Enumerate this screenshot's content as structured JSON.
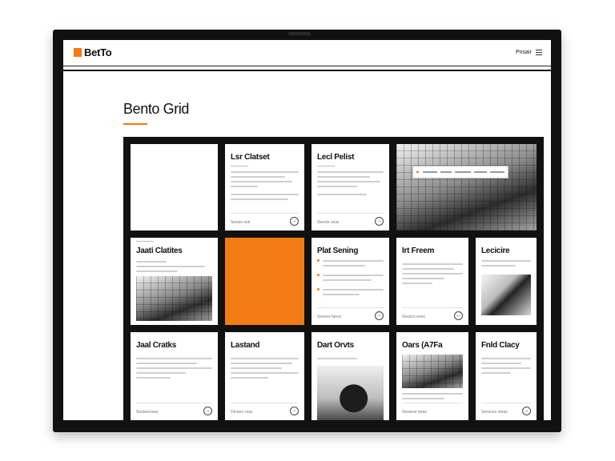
{
  "header": {
    "logo_text": "BetTo",
    "nav_label": "Pnsair",
    "accent_color": "#f27c13"
  },
  "page": {
    "title": "Bento Grid"
  },
  "cards": [
    {
      "id": "blank",
      "title": ""
    },
    {
      "id": "c2",
      "title": "Lsr Clatset",
      "footer": "Sessio ook",
      "icon": "arrow-right-icon"
    },
    {
      "id": "c3",
      "title": "Lecl Pelist",
      "footer": "Seecte seas",
      "icon": "arrow-right-icon"
    },
    {
      "id": "c4",
      "title": "",
      "image": "city-building-photo"
    },
    {
      "id": "c5",
      "title": "Jaati Clatites",
      "image": "street-photo"
    },
    {
      "id": "c6",
      "title": "",
      "fill": "#f27c13"
    },
    {
      "id": "c7",
      "title": "Plat Sening",
      "footer": "Seeses fance",
      "icon": "arrow-right-icon"
    },
    {
      "id": "c8",
      "title": "Irt Freem",
      "footer": "Sesaco eoos",
      "icon": "arrow-right-icon"
    },
    {
      "id": "c9",
      "title": "Lecicire",
      "image": "desk-photo"
    },
    {
      "id": "c10",
      "title": "Jaal Cratks",
      "footer": "Sestacreeas",
      "icon": "arrow-right-icon"
    },
    {
      "id": "c11",
      "title": "Lastand",
      "footer": "Dtooes csas",
      "icon": "arrow-right-icon"
    },
    {
      "id": "c12",
      "title": "Dart Orvts",
      "image": "laptop-photo"
    },
    {
      "id": "c13",
      "title": "Oars (A7Fa",
      "image": "street-photo",
      "footer": "Sesaroe heas"
    },
    {
      "id": "c14",
      "title": "Fnld Clacy",
      "footer": "Seesces oteas",
      "icon": "arrow-right-icon"
    }
  ],
  "icons": {
    "arrow": "→"
  }
}
